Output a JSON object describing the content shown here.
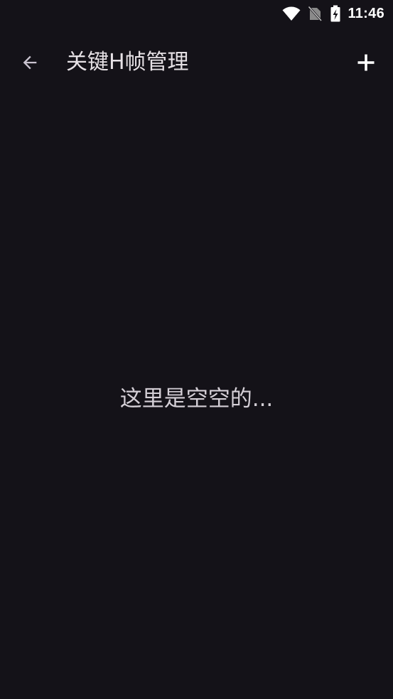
{
  "status_bar": {
    "time": "11:46",
    "icons": [
      "wifi-icon",
      "no-sim-icon",
      "battery-charging-icon"
    ]
  },
  "app_bar": {
    "title": "关键H帧管理",
    "back_icon": "arrow-back-icon",
    "add_icon": "plus-icon"
  },
  "main": {
    "empty_message": "这里是空空的..."
  },
  "colors": {
    "background": "#141218",
    "text": "#e6e1e5",
    "icon": "#ffffff"
  }
}
